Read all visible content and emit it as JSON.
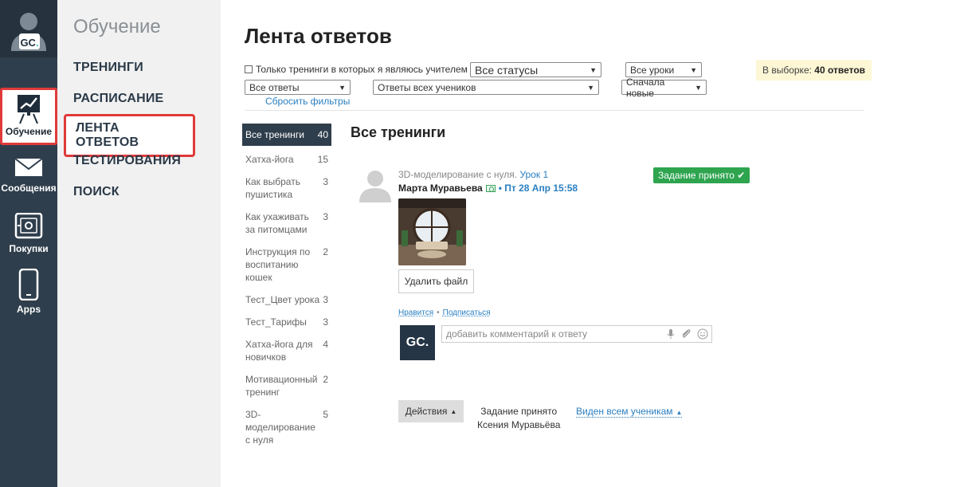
{
  "rail": {
    "items": [
      {
        "label": "Обучение",
        "icon": "training-chart-icon"
      },
      {
        "label": "Сообщения",
        "icon": "envelope-icon"
      },
      {
        "label": "Покупки",
        "icon": "safe-icon"
      },
      {
        "label": "Apps",
        "icon": "phone-icon"
      }
    ],
    "avatar_text": "GC."
  },
  "nav": {
    "title": "Обучение",
    "items": [
      {
        "label": "ТРЕНИНГИ"
      },
      {
        "label": "РАСПИСАНИЕ"
      },
      {
        "label": "ЛЕНТА ОТВЕТОВ"
      },
      {
        "label": "ТЕСТИРОВАНИЯ"
      },
      {
        "label": "ПОИСК"
      }
    ]
  },
  "main": {
    "title": "Лента ответов",
    "filters": {
      "teacher_checkbox_label": "Только тренинги в которых я являюсь учителем",
      "status_select": "Все статусы",
      "lessons_select": "Все уроки",
      "answers_select": "Все ответы",
      "students_select": "Ответы всех учеников",
      "sort_select": "Сначала новые",
      "reset_link": "Сбросить фильтры"
    },
    "count": {
      "prefix": "В выборке:",
      "value": "40 ответов"
    },
    "trainings": [
      {
        "name": "Все тренинги",
        "count": "40"
      },
      {
        "name": "Хатха-йога",
        "count": "15"
      },
      {
        "name": "Как выбрать пушистика",
        "count": "3"
      },
      {
        "name": "Как ухаживать за питомцами",
        "count": "3"
      },
      {
        "name": "Инструкция по воспитанию кошек",
        "count": "2"
      },
      {
        "name": "Тест_Цвет урока",
        "count": "3"
      },
      {
        "name": "Тест_Тарифы",
        "count": "3"
      },
      {
        "name": "Хатха-йога для новичков",
        "count": "4"
      },
      {
        "name": "Мотивационный тренинг",
        "count": "2"
      },
      {
        "name": "3D-моделирование с нуля",
        "count": "5"
      }
    ],
    "section_title": "Все тренинги",
    "entry": {
      "course": "3D-моделирование с нуля.",
      "lesson": "Урок 1",
      "author": "Марта Муравьева",
      "date": "• Пт 28 Апр 15:58",
      "status_badge": "Задание принято ✔",
      "delete_file": "Удалить файл",
      "like": "Нравится",
      "subscribe": "Подписаться",
      "comment_placeholder": "добавить комментарий к ответу",
      "comment_avatar": "GC.",
      "actions": "Действия",
      "status_line1": "Задание принято",
      "status_line2": "Ксения Муравьёва",
      "visibility": "Виден всем ученикам"
    }
  }
}
